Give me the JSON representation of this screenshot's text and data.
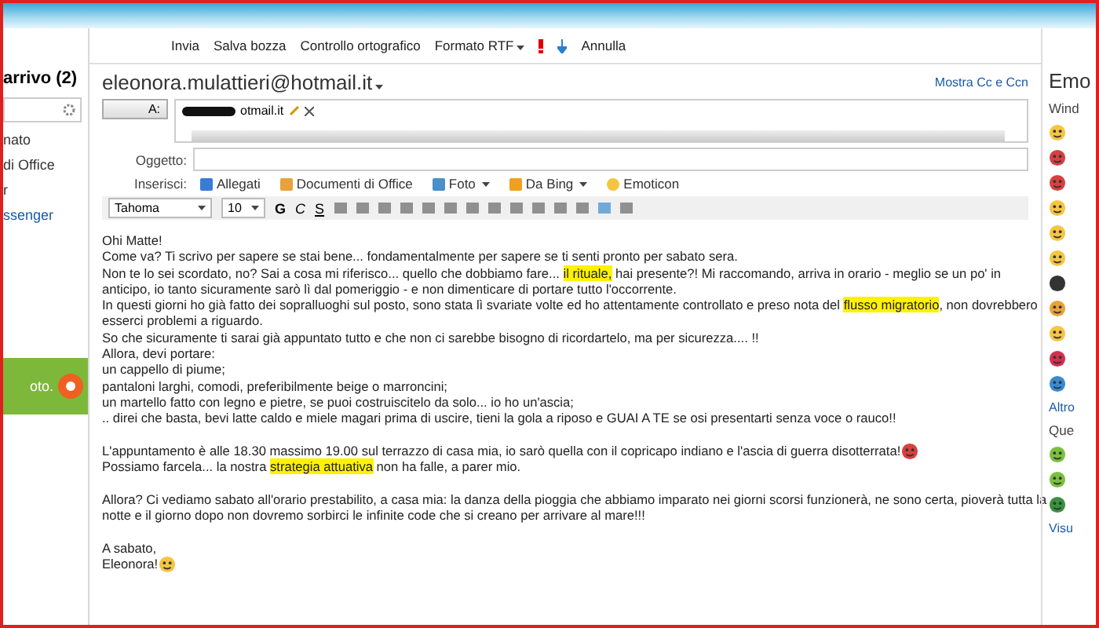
{
  "sidebar": {
    "folder": "arrivo (2)",
    "items": [
      {
        "label": "nato",
        "link": false
      },
      {
        "label": "di Office",
        "link": false
      },
      {
        "label": "r",
        "link": false
      },
      {
        "label": "ssenger",
        "link": true
      }
    ],
    "ad_text": "oto."
  },
  "toolbar": {
    "items": [
      {
        "label": "Invia",
        "kind": "text"
      },
      {
        "label": "Salva bozza",
        "kind": "text"
      },
      {
        "label": "Controllo ortografico",
        "kind": "text"
      },
      {
        "label": "Formato RTF",
        "kind": "menu"
      },
      {
        "kind": "priority"
      },
      {
        "label": "Annulla",
        "kind": "text"
      }
    ]
  },
  "compose": {
    "from": "eleonora.mulattieri@hotmail.it",
    "show_cc": "Mostra Cc e Ccn",
    "to_label": "A:",
    "recipient": "otmail.it",
    "subject_label": "Oggetto:",
    "insert_label": "Inserisci:",
    "insert_items": [
      {
        "label": "Allegati",
        "menu": false
      },
      {
        "label": "Documenti di Office",
        "menu": false
      },
      {
        "label": "Foto",
        "menu": true
      },
      {
        "label": "Da Bing",
        "menu": true
      },
      {
        "label": "Emoticon",
        "menu": false
      }
    ],
    "font": "Tahoma",
    "size": "10",
    "format_buttons": [
      "G",
      "C",
      "S"
    ]
  },
  "body": [
    [
      [
        {
          "text": "Ohi Matte!",
          "highlight": false
        }
      ],
      [
        {
          "text": "Come va? Ti scrivo per sapere se stai bene... fondamentalmente per sapere se ti senti pronto per sabato sera.",
          "highlight": false
        }
      ],
      [
        {
          "text": "Non te lo sei scordato, no? Sai a cosa mi riferisco... quello che dobbiamo fare... ",
          "highlight": false
        },
        {
          "text": "il rituale,",
          "highlight": true
        },
        {
          "text": " hai presente?! Mi raccomando, arriva in orario - meglio se un po' in",
          "highlight": false
        }
      ],
      [
        {
          "text": "anticipo, io tanto sicuramente sarò lì dal pomeriggio - e non dimenticare di portare tutto l'occorrente.",
          "highlight": false
        }
      ],
      [
        {
          "text": "In questi giorni ho già fatto dei sopralluoghi sul posto, sono stata lì svariate volte ed ho attentamente controllato e preso nota del ",
          "highlight": false
        },
        {
          "text": "flusso migratorio",
          "highlight": true
        },
        {
          "text": ", non dovrebbero",
          "highlight": false
        }
      ],
      [
        {
          "text": "esserci problemi a riguardo.",
          "highlight": false
        }
      ],
      [
        {
          "text": "So che sicuramente ti sarai già appuntato tutto e che non ci sarebbe bisogno di ricordartelo, ma per sicurezza.... !!",
          "highlight": false
        }
      ],
      [
        {
          "text": "Allora, devi portare:",
          "highlight": false
        }
      ],
      [
        {
          "text": "un cappello di piume;",
          "highlight": false
        }
      ],
      [
        {
          "text": "pantaloni larghi, comodi, preferibilmente beige o marroncini;",
          "highlight": false
        }
      ],
      [
        {
          "text": "un martello fatto con legno e pietre, se puoi costruiscitelo da solo... io ho un'ascia;",
          "highlight": false
        }
      ],
      [
        {
          "text": ".. direi che basta, bevi latte caldo e miele magari prima di uscire, tieni la gola a riposo e GUAI A TE se osi presentarti senza voce o rauco!!",
          "highlight": false
        }
      ]
    ],
    [
      [
        {
          "text": "L'appuntamento è alle 18.30 massimo 19.00 sul terrazzo di casa mia, io sarò quella con il copricapo indiano e l'ascia di guerra disotterrata!",
          "highlight": false
        },
        {
          "kind": "devil"
        }
      ],
      [
        {
          "text": "Possiamo farcela... la nostra ",
          "highlight": false
        },
        {
          "text": "strategia attuativa",
          "highlight": true
        },
        {
          "text": " non ha falle, a parer mio.",
          "highlight": false
        }
      ]
    ],
    [
      [
        {
          "text": "Allora? Ci vediamo sabato all'orario prestabilito, a casa mia: la danza della pioggia che abbiamo imparato nei giorni scorsi funzionerà, ne sono certa, pioverà tutta la",
          "highlight": false
        }
      ],
      [
        {
          "text": "notte e il giorno dopo non dovremo sorbirci le infinite code che si creano per arrivare al mare!!!",
          "highlight": false
        }
      ]
    ],
    [
      [
        {
          "text": "A sabato,",
          "highlight": false
        }
      ],
      [
        {
          "text": "Eleonora!",
          "highlight": false
        },
        {
          "kind": "grin"
        }
      ]
    ]
  ],
  "emoticons": {
    "title": "Emo",
    "section": "Wind",
    "more": "Altro",
    "section2": "Que",
    "view": "Visu"
  }
}
